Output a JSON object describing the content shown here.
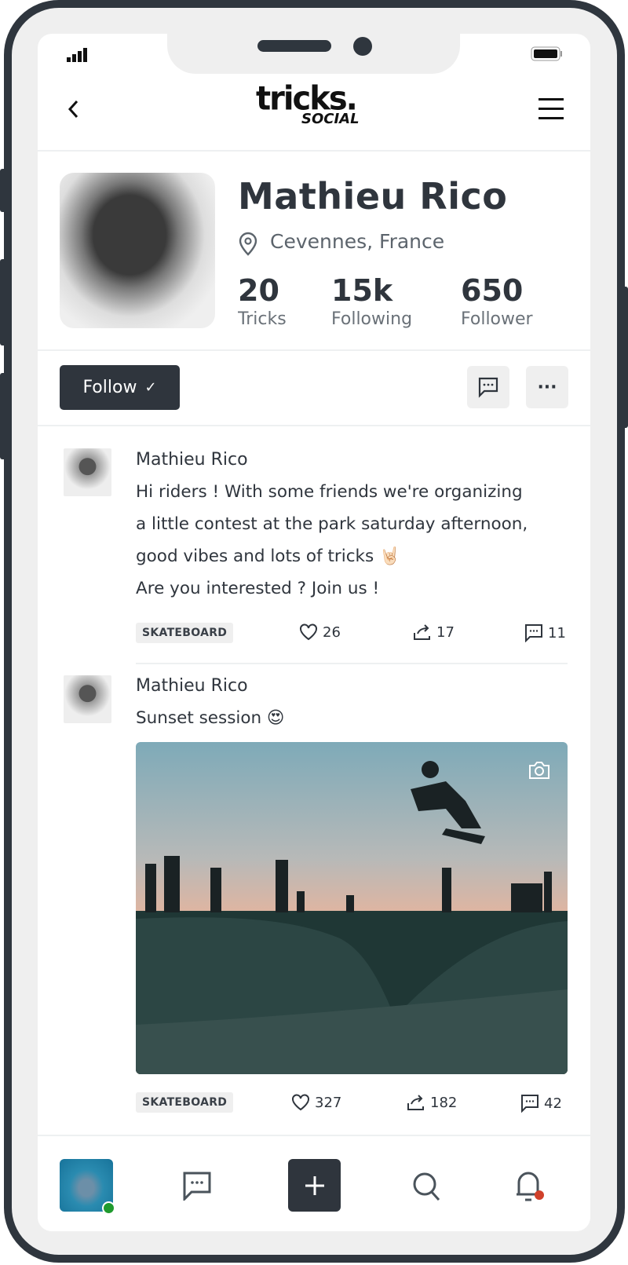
{
  "status": {
    "signal_icon": "signal-icon",
    "battery_icon": "battery-icon"
  },
  "header": {
    "logo_main": "tricks.",
    "logo_sub": "SOCIAL",
    "back_icon": "chevron-left-icon",
    "menu_icon": "hamburger-icon"
  },
  "profile": {
    "name": "Mathieu Rico",
    "location": "Cevennes, France",
    "stats": [
      {
        "value": "20",
        "label": "Tricks"
      },
      {
        "value": "15k",
        "label": "Following"
      },
      {
        "value": "650",
        "label": "Follower"
      }
    ]
  },
  "actions": {
    "follow_label": "Follow",
    "follow_check": "✓",
    "more_label": "···"
  },
  "posts": [
    {
      "author": "Mathieu Rico",
      "lines": [
        "Hi riders ! With some friends we're organizing",
        "a little contest at the park saturday afternoon,",
        "good vibes and lots of tricks 🤘🏻",
        "Are you interested ? Join us !"
      ],
      "tag": "SKATEBOARD",
      "likes": "26",
      "shares": "17",
      "comments": "11"
    },
    {
      "author": "Mathieu Rico",
      "lines": [
        "Sunset session 😍"
      ],
      "tag": "SKATEBOARD",
      "likes": "327",
      "shares": "182",
      "comments": "42"
    }
  ],
  "colors": {
    "dark": "#2f353d",
    "light": "#efefef",
    "online": "#1f9a2e",
    "notification": "#d0402a"
  }
}
